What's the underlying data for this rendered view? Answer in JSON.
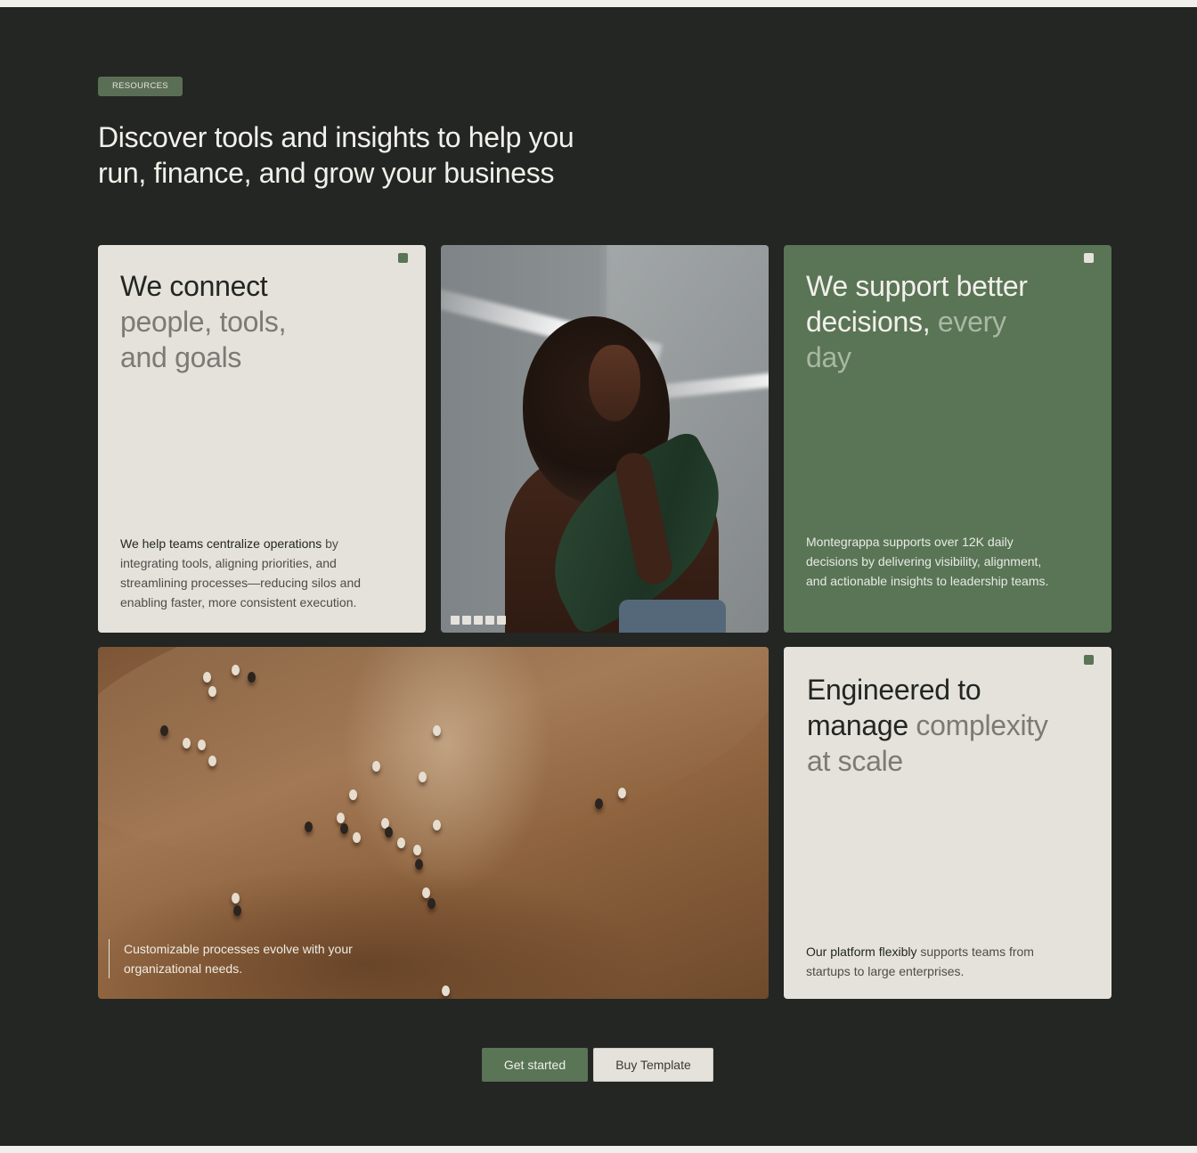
{
  "badge": "RESOURCES",
  "headline": {
    "line1": "Discover tools and insights to help you",
    "line2": "run, finance, and grow your business"
  },
  "card_connect": {
    "title_strong": "We connect",
    "title_muted_1": "people, tools,",
    "title_muted_2": "and goals",
    "body_strong": "We help teams centralize operations",
    "body_rest": " by integrating tools, aligning priorities, and streamlining processes—reducing silos and enabling faster, more consistent execution."
  },
  "card_support": {
    "title_line1": "We support better",
    "title_strong_2": "decisions,",
    "title_muted_2": " every",
    "title_muted_3": "day",
    "body": "Montegrappa supports over 12K daily decisions by delivering visibility, alignment, and actionable insights to leadership teams."
  },
  "card_field": {
    "quote_line1": "Customizable processes evolve with your",
    "quote_line2": "organizational needs."
  },
  "card_engineered": {
    "title_strong_1": "Engineered to",
    "title_strong_2": "manage",
    "title_muted_2": " complexity",
    "title_muted_3": "at scale",
    "body_strong": "Our platform flexibly",
    "body_rest": " supports teams from startups to large enterprises."
  },
  "buttons": {
    "primary": "Get started",
    "secondary": "Buy Template"
  },
  "carousel": {
    "slides": 5,
    "active": 1
  },
  "colors": {
    "background": "#232622",
    "card_light": "#e5e2dc",
    "card_green": "#5a7456",
    "accent": "#5a6e55"
  },
  "icons": [
    "corner-square-icon"
  ]
}
